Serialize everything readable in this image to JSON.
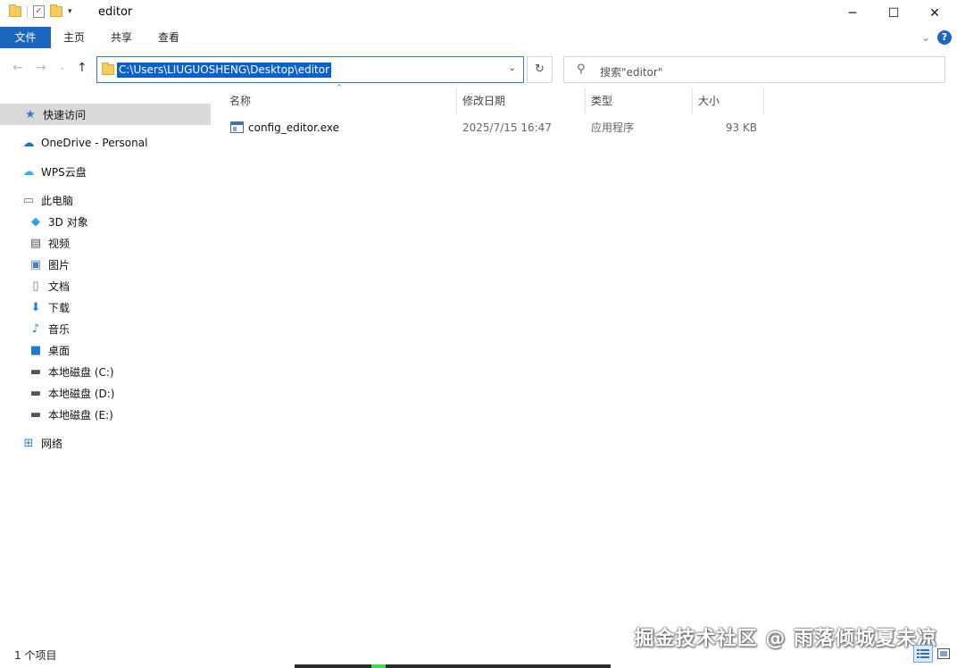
{
  "window": {
    "title": "editor",
    "minimize_glyph": "─",
    "maximize_glyph": "☐",
    "close_glyph": "✕"
  },
  "ribbon": {
    "tabs": [
      {
        "label": "文件"
      },
      {
        "label": "主页"
      },
      {
        "label": "共享"
      },
      {
        "label": "查看"
      }
    ],
    "help_glyph": "?"
  },
  "address": {
    "path": "C:\\Users\\LIUGUOSHENG\\Desktop\\editor",
    "search_placeholder": "搜索\"editor\""
  },
  "nav": {
    "items": [
      {
        "label": "快速访问",
        "icon": "star-icon"
      },
      {
        "label": "OneDrive - Personal",
        "icon": "cloud-icon"
      },
      {
        "label": "WPS云盘",
        "icon": "cloud-icon"
      },
      {
        "label": "此电脑",
        "icon": "computer-icon"
      },
      {
        "label": "3D 对象",
        "icon": "cube-icon"
      },
      {
        "label": "视频",
        "icon": "film-icon"
      },
      {
        "label": "图片",
        "icon": "picture-icon"
      },
      {
        "label": "文档",
        "icon": "document-icon"
      },
      {
        "label": "下载",
        "icon": "download-arrow-icon"
      },
      {
        "label": "音乐",
        "icon": "music-note-icon"
      },
      {
        "label": "桌面",
        "icon": "desktop-icon"
      },
      {
        "label": "本地磁盘 (C:)",
        "icon": "drive-icon"
      },
      {
        "label": "本地磁盘 (D:)",
        "icon": "drive-icon"
      },
      {
        "label": "本地磁盘 (E:)",
        "icon": "drive-icon"
      },
      {
        "label": "网络",
        "icon": "network-icon"
      }
    ]
  },
  "columns": {
    "name": "名称",
    "modified": "修改日期",
    "type": "类型",
    "size": "大小"
  },
  "files": [
    {
      "name": "config_editor.exe",
      "modified": "2025/7/15 16:47",
      "type": "应用程序",
      "size": "93 KB"
    }
  ],
  "status": {
    "count_text": "1 个项目"
  },
  "watermark": "掘金技术社区 @ 雨落倾城夏未凉",
  "colors": {
    "accent": "#1a67c0",
    "selection": "#0a61c9",
    "nav_selected": "#d9d9d9"
  }
}
